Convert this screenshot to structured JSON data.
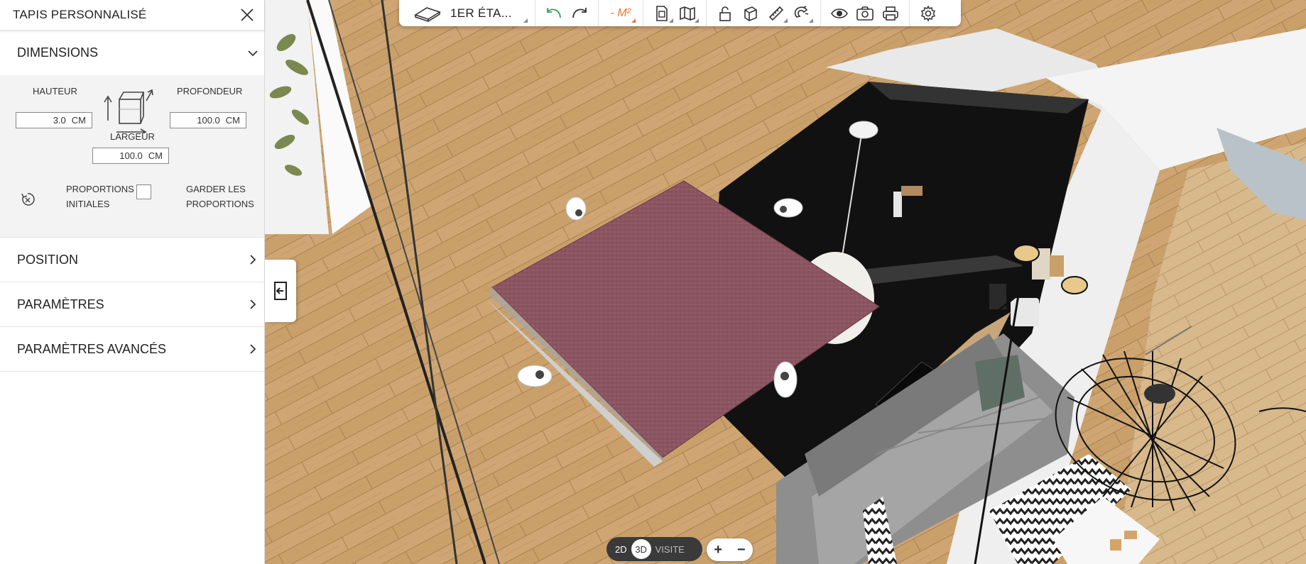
{
  "panel": {
    "title": "TAPIS PERSONNALISÉ",
    "sections": {
      "dimensions": "DIMENSIONS",
      "position": "POSITION",
      "parametres": "PARAMÈTRES",
      "avances": "PARAMÈTRES AVANCÉS"
    },
    "dimensions": {
      "hauteur_label": "HAUTEUR",
      "hauteur_value": "3.0",
      "profondeur_label": "PROFONDEUR",
      "profondeur_value": "100.0",
      "largeur_label": "LARGEUR",
      "largeur_value": "100.0",
      "unit": "CM",
      "proportions_line1": "PROPORTIONS",
      "proportions_line2": "INITIALES",
      "keep_line1": "GARDER LES",
      "keep_line2": "PROPORTIONS"
    }
  },
  "toolbar": {
    "floor_name": "1ER ÉTA...",
    "area_label": "- M²"
  },
  "view_modes": {
    "mode_2d": "2D",
    "mode_3d": "3D",
    "mode_visit": "VISITE",
    "active": "3D"
  },
  "zoom": {
    "plus": "+",
    "minus": "−"
  },
  "colors": {
    "accent_orange": "#e8742c",
    "undo_green": "#3a9a5b",
    "rug": "#8a5560",
    "floor": "#c9a06a"
  }
}
